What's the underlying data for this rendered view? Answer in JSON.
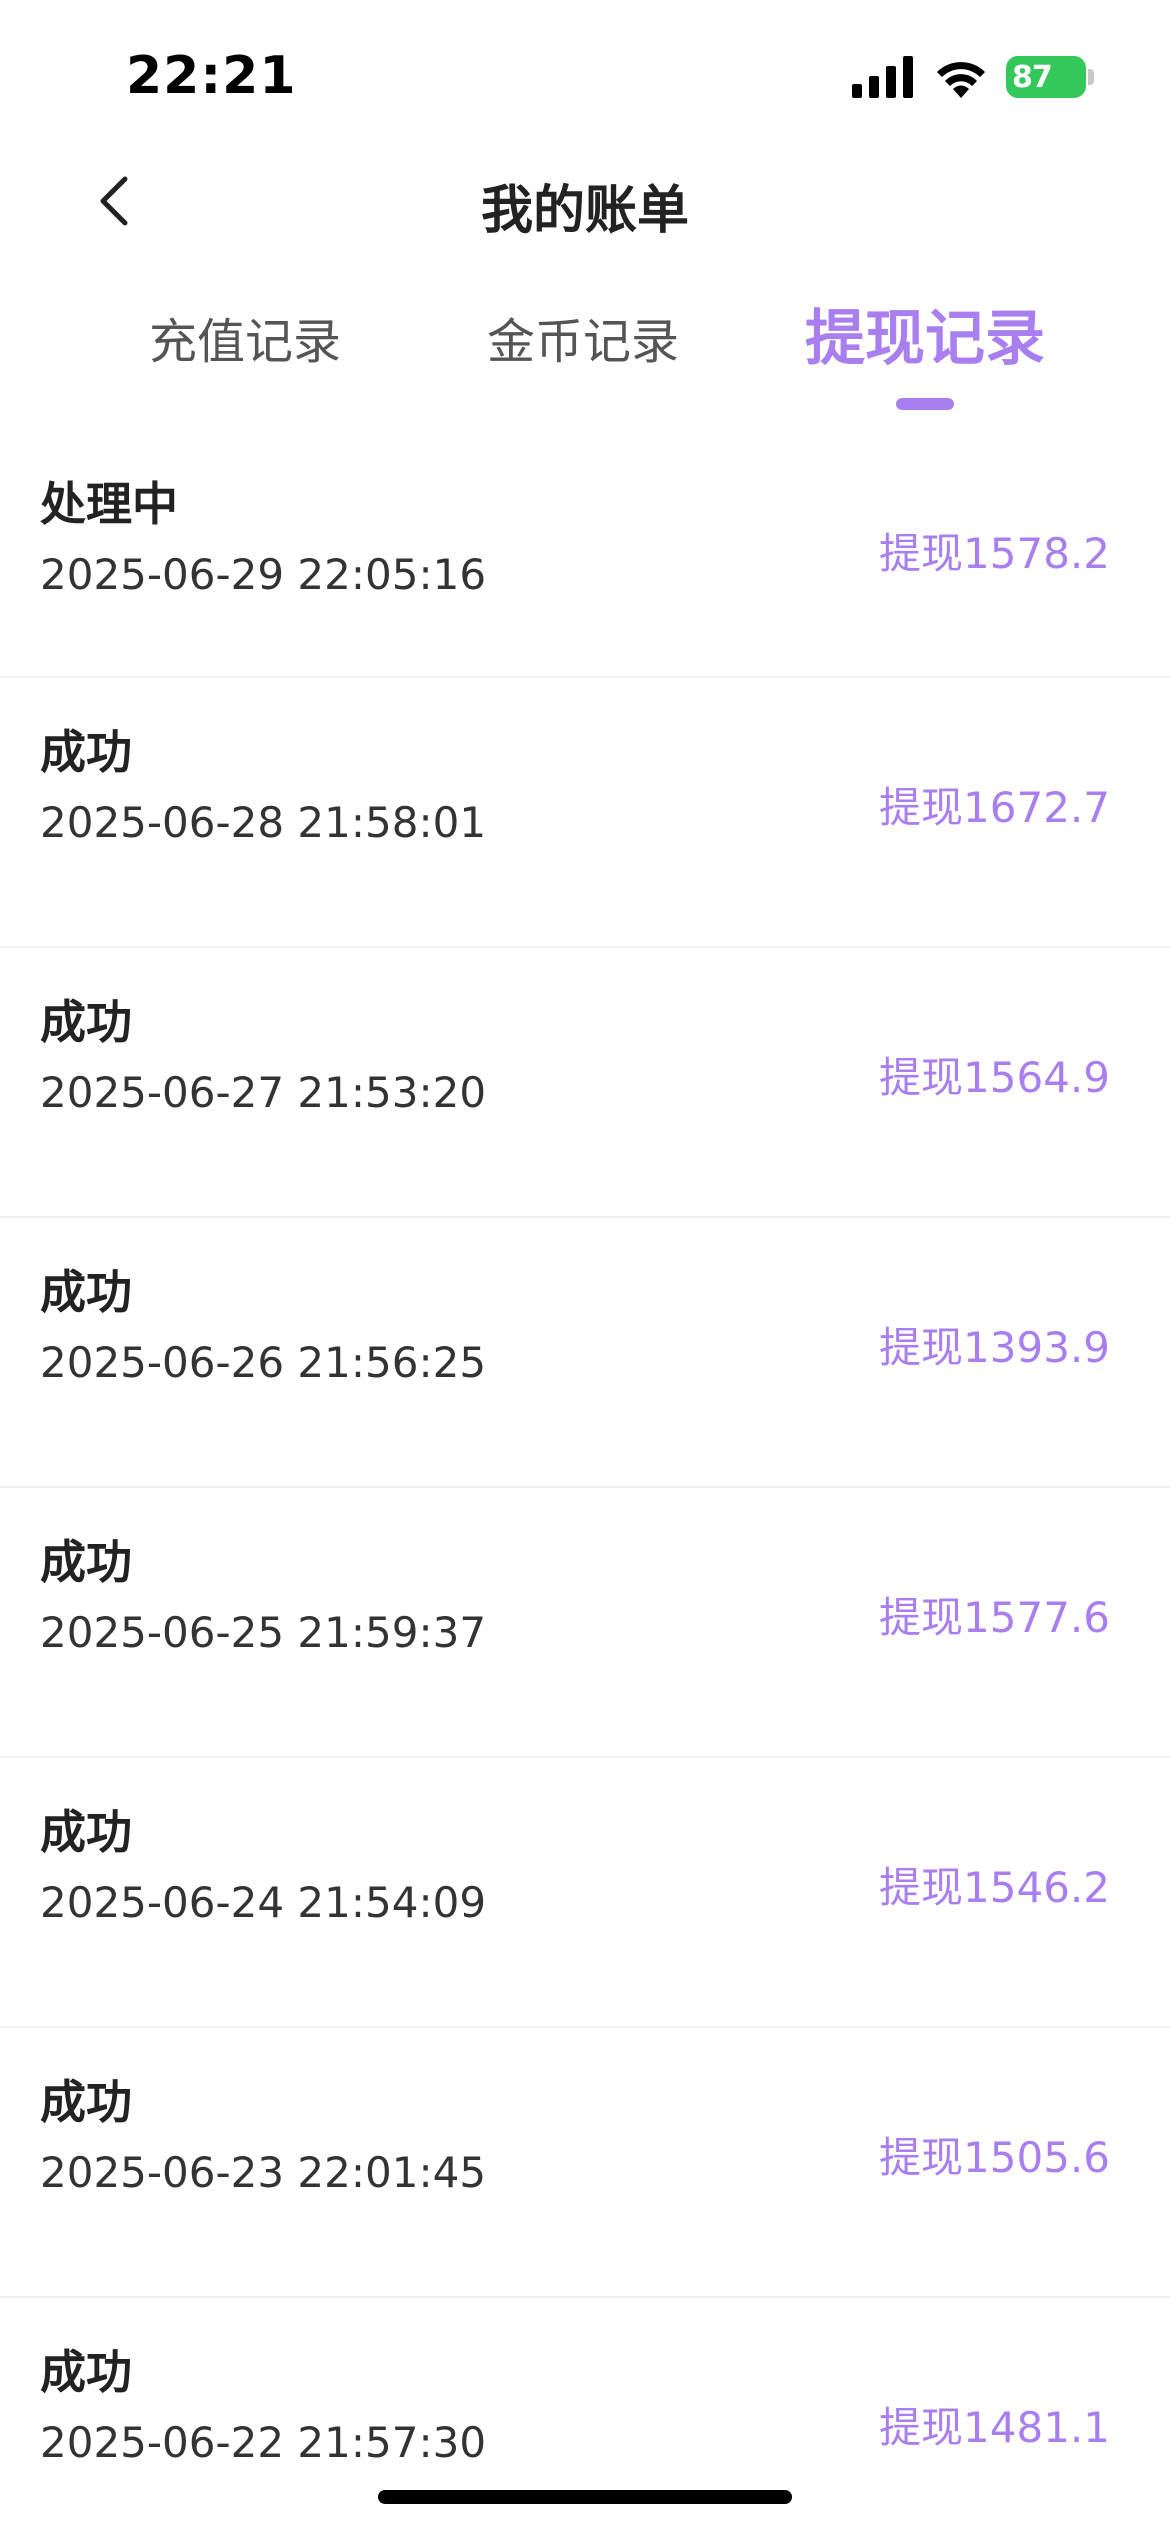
{
  "status_bar": {
    "time": "22:21",
    "battery_level": "87",
    "battery_color": "#34c759"
  },
  "header": {
    "title": "我的账单",
    "back_icon": "chevron-left-icon"
  },
  "tabs": [
    {
      "label": "充值记录",
      "active": false
    },
    {
      "label": "金币记录",
      "active": false
    },
    {
      "label": "提现记录",
      "active": true
    }
  ],
  "accent_color": "#a97ff0",
  "records": [
    {
      "status": "处理中",
      "time": "2025-06-29 22:05:16",
      "amount": "提现1578.2"
    },
    {
      "status": "成功",
      "time": "2025-06-28 21:58:01",
      "amount": "提现1672.7"
    },
    {
      "status": "成功",
      "time": "2025-06-27 21:53:20",
      "amount": "提现1564.9"
    },
    {
      "status": "成功",
      "time": "2025-06-26 21:56:25",
      "amount": "提现1393.9"
    },
    {
      "status": "成功",
      "time": "2025-06-25 21:59:37",
      "amount": "提现1577.6"
    },
    {
      "status": "成功",
      "time": "2025-06-24 21:54:09",
      "amount": "提现1546.2"
    },
    {
      "status": "成功",
      "time": "2025-06-23 22:01:45",
      "amount": "提现1505.6"
    },
    {
      "status": "成功",
      "time": "2025-06-22 21:57:30",
      "amount": "提现1481.1"
    }
  ]
}
